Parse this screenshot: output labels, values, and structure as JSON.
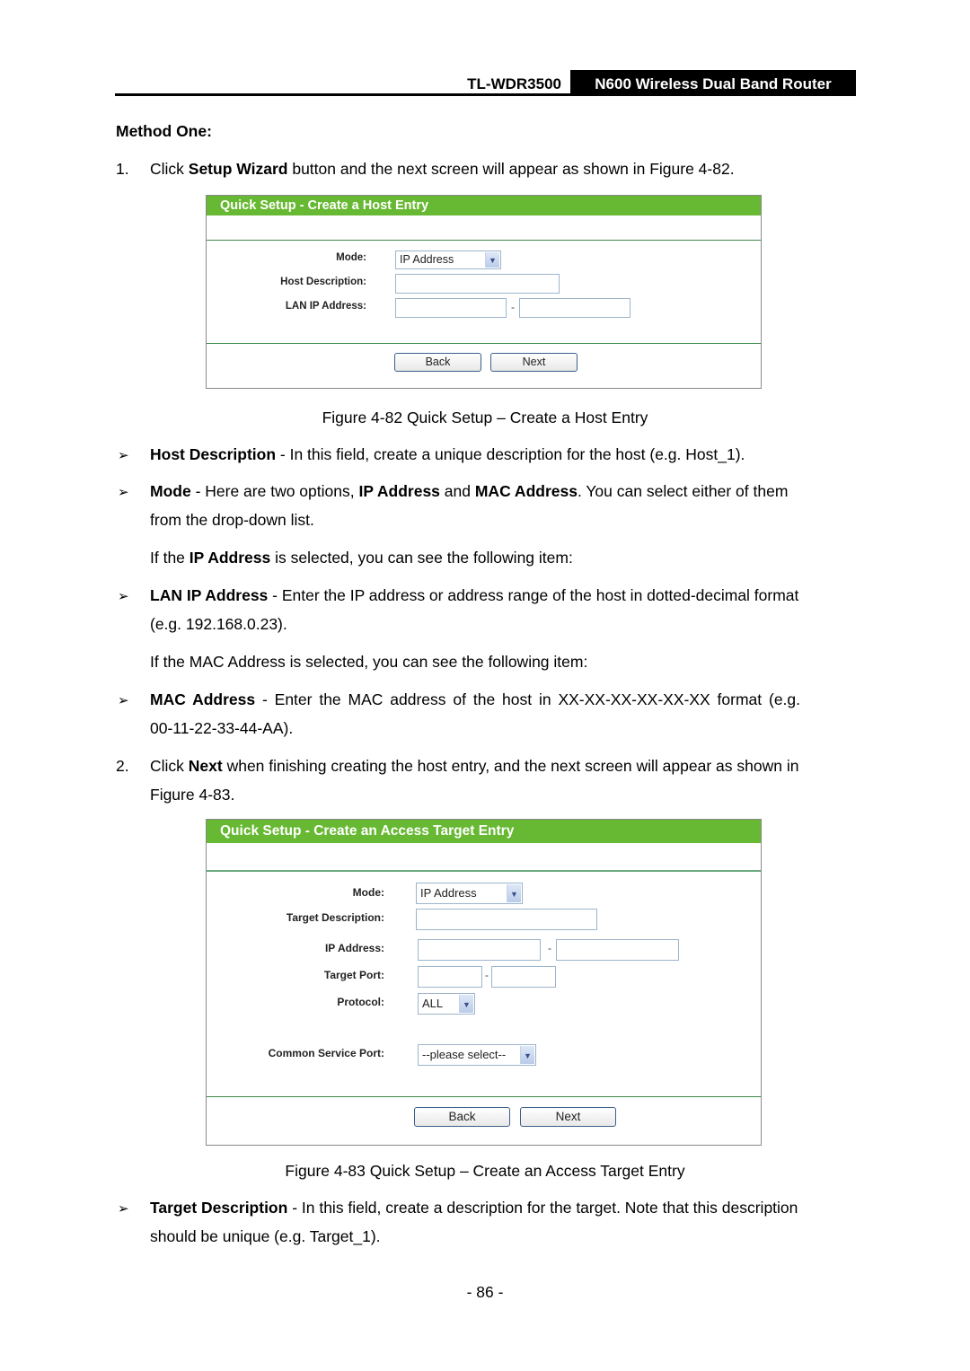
{
  "header": {
    "model": "TL-WDR3500",
    "product": "N600 Wireless Dual Band Router"
  },
  "section_heading": "Method One:",
  "step1": {
    "number": "1.",
    "pre": "Click ",
    "bold": "Setup Wizard",
    "post": " button and the next screen will appear as shown in Figure 4-82."
  },
  "figure1": {
    "title": "Quick Setup - Create a Host Entry",
    "fields": {
      "mode_label": "Mode:",
      "mode_value": "IP Address",
      "host_desc_label": "Host Description:",
      "host_desc_value": "",
      "lan_ip_label": "LAN IP Address:",
      "lan_ip_start": "",
      "lan_ip_end": "",
      "range_separator": "-"
    },
    "buttons": {
      "back": "Back",
      "next": "Next"
    },
    "caption": "Figure 4-82 Quick Setup – Create a Host Entry"
  },
  "bullets1": [
    {
      "bold": "Host Description",
      "text": " - In this field, create a unique description for the host (e.g. Host_1)."
    },
    {
      "bold": "Mode",
      "text": " - Here are two options, ",
      "bold2": "IP Address",
      "text2": " and ",
      "bold3": "MAC Address",
      "text3": ". You can select either of them",
      "line2": "from the drop-down list."
    }
  ],
  "note_ip": {
    "pre": "If the ",
    "bold": "IP Address",
    "post": " is selected, you can see the following item:"
  },
  "bullet_lan": {
    "bold": "LAN IP Address",
    "text": " - Enter the IP address or address range of the host in dotted-decimal format",
    "line2": "(e.g. 192.168.0.23)."
  },
  "note_mac": "If the MAC Address is selected, you can see the following item:",
  "bullet_mac": {
    "bold": "MAC Address",
    "text": " - Enter the MAC address of the host in XX-XX-XX-XX-XX-XX format (e.g.",
    "line2": "00-11-22-33-44-AA)."
  },
  "step2": {
    "number": "2.",
    "pre": "Click ",
    "bold": "Next",
    "post": " when finishing creating the host entry, and the next screen will appear as shown in",
    "line2": "Figure 4-83."
  },
  "figure2": {
    "title": "Quick Setup - Create an Access Target Entry",
    "fields": {
      "mode_label": "Mode:",
      "mode_value": "IP Address",
      "target_desc_label": "Target Description:",
      "ip_label": "IP Address:",
      "port_label": "Target Port:",
      "protocol_label": "Protocol:",
      "protocol_value": "ALL",
      "service_label": "Common Service Port:",
      "service_value": "--please select--",
      "range_separator": "-"
    },
    "buttons": {
      "back": "Back",
      "next": "Next"
    },
    "caption": "Figure 4-83 Quick Setup – Create an Access Target Entry"
  },
  "bullet_target": {
    "bold": "Target Description",
    "text": " - In this field, create a description for the target. Note that this description",
    "line2": "should be unique (e.g. Target_1)."
  },
  "page_number": "- 86 -",
  "icons": {
    "bullet": "➢",
    "dropdown": "▼"
  },
  "colors": {
    "panel_title_bg": "#67b832",
    "separator": "#3f8a4a"
  }
}
